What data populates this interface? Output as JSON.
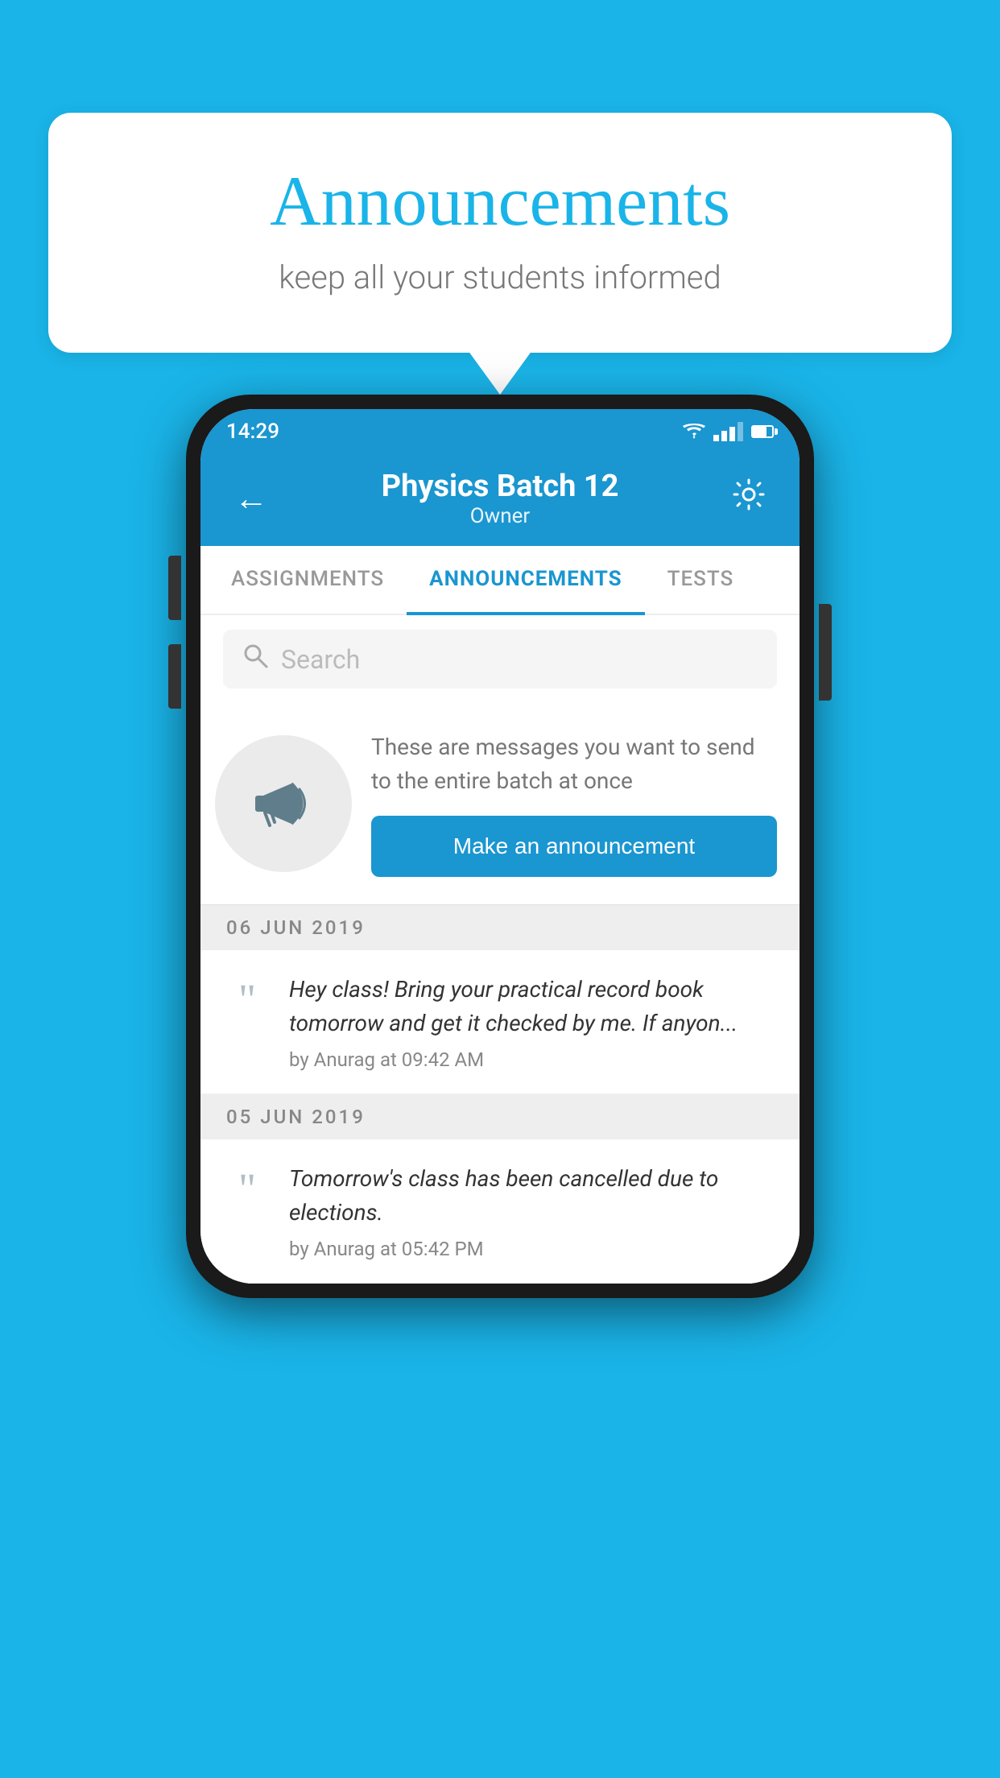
{
  "page": {
    "background_color": "#1ab4e8"
  },
  "speech_bubble": {
    "title": "Announcements",
    "subtitle": "keep all your students informed"
  },
  "phone": {
    "status_bar": {
      "time": "14:29"
    },
    "header": {
      "back_label": "←",
      "title": "Physics Batch 12",
      "subtitle": "Owner",
      "settings_label": "⚙"
    },
    "tabs": [
      {
        "label": "ASSIGNMENTS",
        "active": false
      },
      {
        "label": "ANNOUNCEMENTS",
        "active": true
      },
      {
        "label": "TESTS",
        "active": false
      }
    ],
    "search": {
      "placeholder": "Search"
    },
    "promo": {
      "description": "These are messages you want to send to the entire batch at once",
      "button_label": "Make an announcement"
    },
    "announcements": [
      {
        "date": "06  JUN  2019",
        "text": "Hey class! Bring your practical record book tomorrow and get it checked by me. If anyon...",
        "meta": "by Anurag at 09:42 AM"
      },
      {
        "date": "05  JUN  2019",
        "text": "Tomorrow's class has been cancelled due to elections.",
        "meta": "by Anurag at 05:42 PM"
      }
    ]
  }
}
